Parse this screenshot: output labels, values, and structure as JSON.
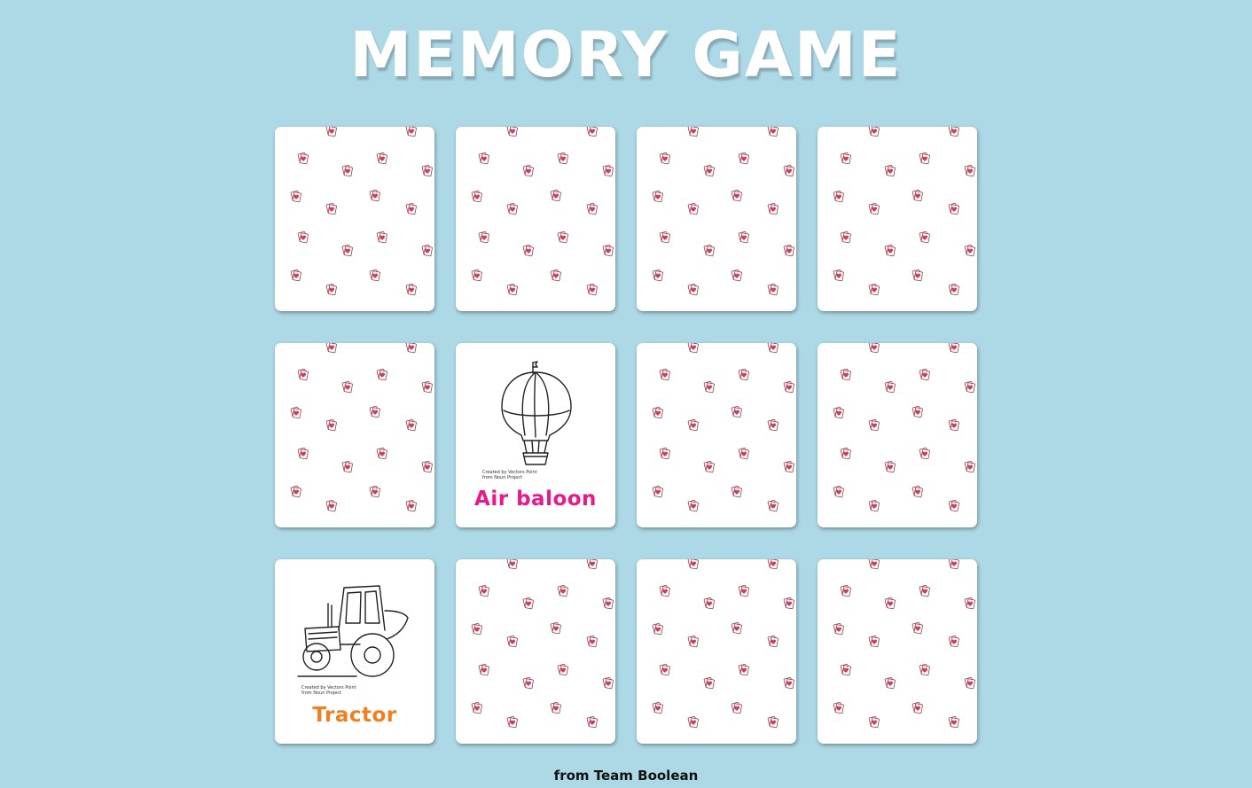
{
  "header": {
    "title": "MEMORY GAME"
  },
  "board": {
    "cards": [
      {
        "state": "face-down"
      },
      {
        "state": "face-down"
      },
      {
        "state": "face-down"
      },
      {
        "state": "face-down"
      },
      {
        "state": "face-down"
      },
      {
        "state": "face-up",
        "icon": "air-balloon-icon",
        "label": "Air baloon",
        "credit_line1": "Created by Vectors Point",
        "credit_line2": "from Noun Project",
        "label_color": "#e8198b"
      },
      {
        "state": "face-down"
      },
      {
        "state": "face-down"
      },
      {
        "state": "face-up",
        "icon": "tractor-icon",
        "label": "Tractor",
        "credit_line1": "Created by Vectors Point",
        "credit_line2": "from Noun Project",
        "label_color": "#f07f1e"
      },
      {
        "state": "face-down"
      },
      {
        "state": "face-down"
      },
      {
        "state": "face-down"
      }
    ]
  },
  "footer": {
    "text": "from Team Boolean"
  },
  "colors": {
    "background": "#add8e6",
    "card": "#ffffff",
    "card_back_icon": "#d23b55"
  }
}
